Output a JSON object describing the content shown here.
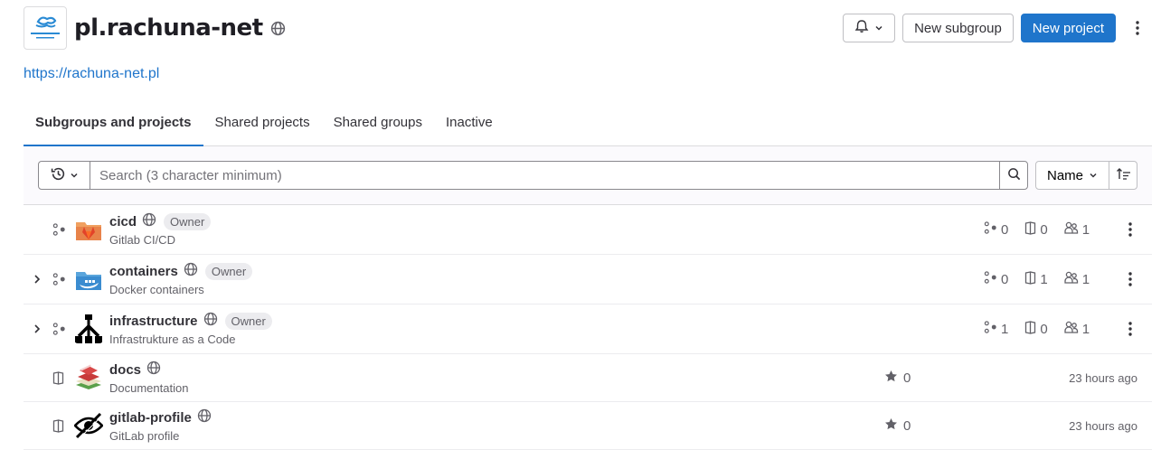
{
  "group": {
    "name": "pl.rachuna-net",
    "url": "https://rachuna-net.pl",
    "visibility_icon": "globe-icon"
  },
  "actions": {
    "notifications_icon": "bell-icon",
    "new_subgroup": "New subgroup",
    "new_project": "New project"
  },
  "tabs": [
    "Subgroups and projects",
    "Shared projects",
    "Shared groups",
    "Inactive"
  ],
  "filter": {
    "search_placeholder": "Search (3 character minimum)",
    "sort_label": "Name"
  },
  "items": [
    {
      "type": "subgroup",
      "name": "cicd",
      "description": "Gitlab CI/CD",
      "badge": "Owner",
      "subgroups": "0",
      "projects": "0",
      "members": "1",
      "expandable": false
    },
    {
      "type": "subgroup",
      "name": "containers",
      "description": "Docker containers",
      "badge": "Owner",
      "subgroups": "0",
      "projects": "1",
      "members": "1",
      "expandable": true
    },
    {
      "type": "subgroup",
      "name": "infrastructure",
      "description": "Infrastrukture as a Code",
      "badge": "Owner",
      "subgroups": "1",
      "projects": "0",
      "members": "1",
      "expandable": true
    },
    {
      "type": "project",
      "name": "docs",
      "description": "Documentation",
      "stars": "0",
      "updated": "23 hours ago"
    },
    {
      "type": "project",
      "name": "gitlab-profile",
      "description": "GitLab profile",
      "stars": "0",
      "updated": "23 hours ago"
    }
  ],
  "colors": {
    "accent": "#1f75cb",
    "text": "#333238",
    "muted": "#626168"
  }
}
